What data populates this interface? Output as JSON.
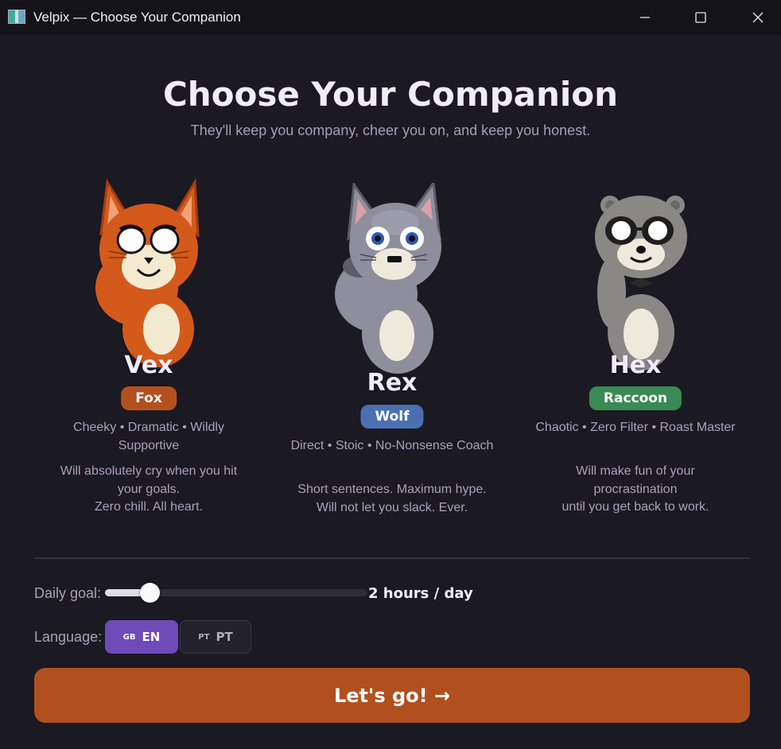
{
  "window": {
    "title": "Velpix — Choose Your Companion",
    "minimize_glyph": "—",
    "maximize_glyph": "☐",
    "close_glyph": "✕"
  },
  "header": {
    "title": "Choose Your Companion",
    "subtitle": "They'll keep you company, cheer you on, and keep you honest."
  },
  "companions": [
    {
      "name": "Vex",
      "species": "Fox",
      "badge_color": "#b4501f",
      "traits": "Cheeky • Dramatic • Wildly Supportive",
      "desc_lines": [
        "Will absolutely cry when you hit",
        "your goals.",
        "Zero chill. All heart."
      ],
      "icon": "fox-mascot-icon"
    },
    {
      "name": "Rex",
      "species": "Wolf",
      "badge_color": "#4a70b2",
      "traits": "Direct • Stoic • No-Nonsense Coach",
      "desc_lines": [
        "Short sentences. Maximum hype.",
        "Will not let you slack. Ever."
      ],
      "icon": "wolf-mascot-icon"
    },
    {
      "name": "Hex",
      "species": "Raccoon",
      "badge_color": "#3a8a55",
      "traits": "Chaotic • Zero Filter • Roast Master",
      "desc_lines": [
        "Will make fun of your",
        "procrastination",
        "until you get back to work."
      ],
      "icon": "raccoon-mascot-icon"
    }
  ],
  "settings": {
    "goal_label": "Daily goal:",
    "goal_value": "2 hours / day",
    "goal_slider_fraction": 0.17,
    "language_label": "Language:",
    "languages": [
      {
        "flag": "GB",
        "code": "EN",
        "selected": true
      },
      {
        "flag": "PT",
        "code": "PT",
        "selected": false
      }
    ]
  },
  "cta": {
    "label": "Let's go! →"
  }
}
